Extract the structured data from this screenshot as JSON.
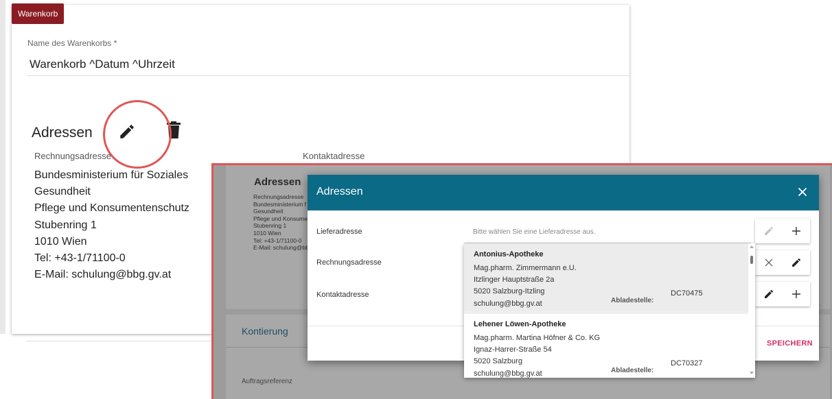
{
  "basket": {
    "tag": "Warenkorb",
    "name_label": "Name des Warenkorbs *",
    "name_value": "Warenkorb ^Datum ^Uhrzeit"
  },
  "addresses": {
    "title": "Adressen",
    "billing_label": "Rechnungsadresse",
    "contact_label": "Kontaktadresse",
    "billing_lines": "Bundesministerium für Soziales\nGesundheit\nPflege und Konsumentenschutz\nStubenring 1\n1010 Wien\nTel: +43-1/71100-0\nE-Mail: schulung@bbg.gv.at"
  },
  "inset": {
    "title": "Adressen",
    "small_lines": "Rechnungsadresse\nBundesministerium f\nGesundheit\nPflege und Konsume\nStubenring 1\n1010 Wien\nTel: +43-1/71100-0\nE-Mail: schulung@bb",
    "kontierung": "Kontierung",
    "auftragsreferenz": "Auftragsreferenz"
  },
  "modal": {
    "title": "Adressen",
    "lieferadresse_label": "Lieferadresse",
    "rechnungsadresse_label": "Rechnungsadresse",
    "kontaktadresse_label": "Kontaktadresse",
    "placeholder": "Bitte wählen Sie eine Lieferadresse aus.",
    "save_label": "SPEICHERN"
  },
  "dropdown": {
    "items": [
      {
        "name": "Antonius-Apotheke",
        "lines": "Mag.pharm. Zimmermann e.U.\nItzlinger Hauptstraße 2a\n5020 Salzburg-Itzling\nschulung@bbg.gv.at",
        "ablade_label": "Abladestelle:",
        "code": "DC70475"
      },
      {
        "name": "Lehener Löwen-Apotheke",
        "lines": "Mag.pharm. Martina Höfner & Co. KG\nIgnaz-Harrer-Straße 54\n5020 Salzburg\nschulung@bbg.gv.at",
        "ablade_label": "Abladestelle:",
        "code": "DC70327"
      }
    ]
  },
  "colors": {
    "tag": "#8b1c24",
    "modal_header": "#0b6a86",
    "save": "#d0306a",
    "highlight": "#e05656"
  },
  "icons": [
    "pencil-icon",
    "trash-icon",
    "close-icon",
    "plus-icon",
    "x-icon"
  ]
}
